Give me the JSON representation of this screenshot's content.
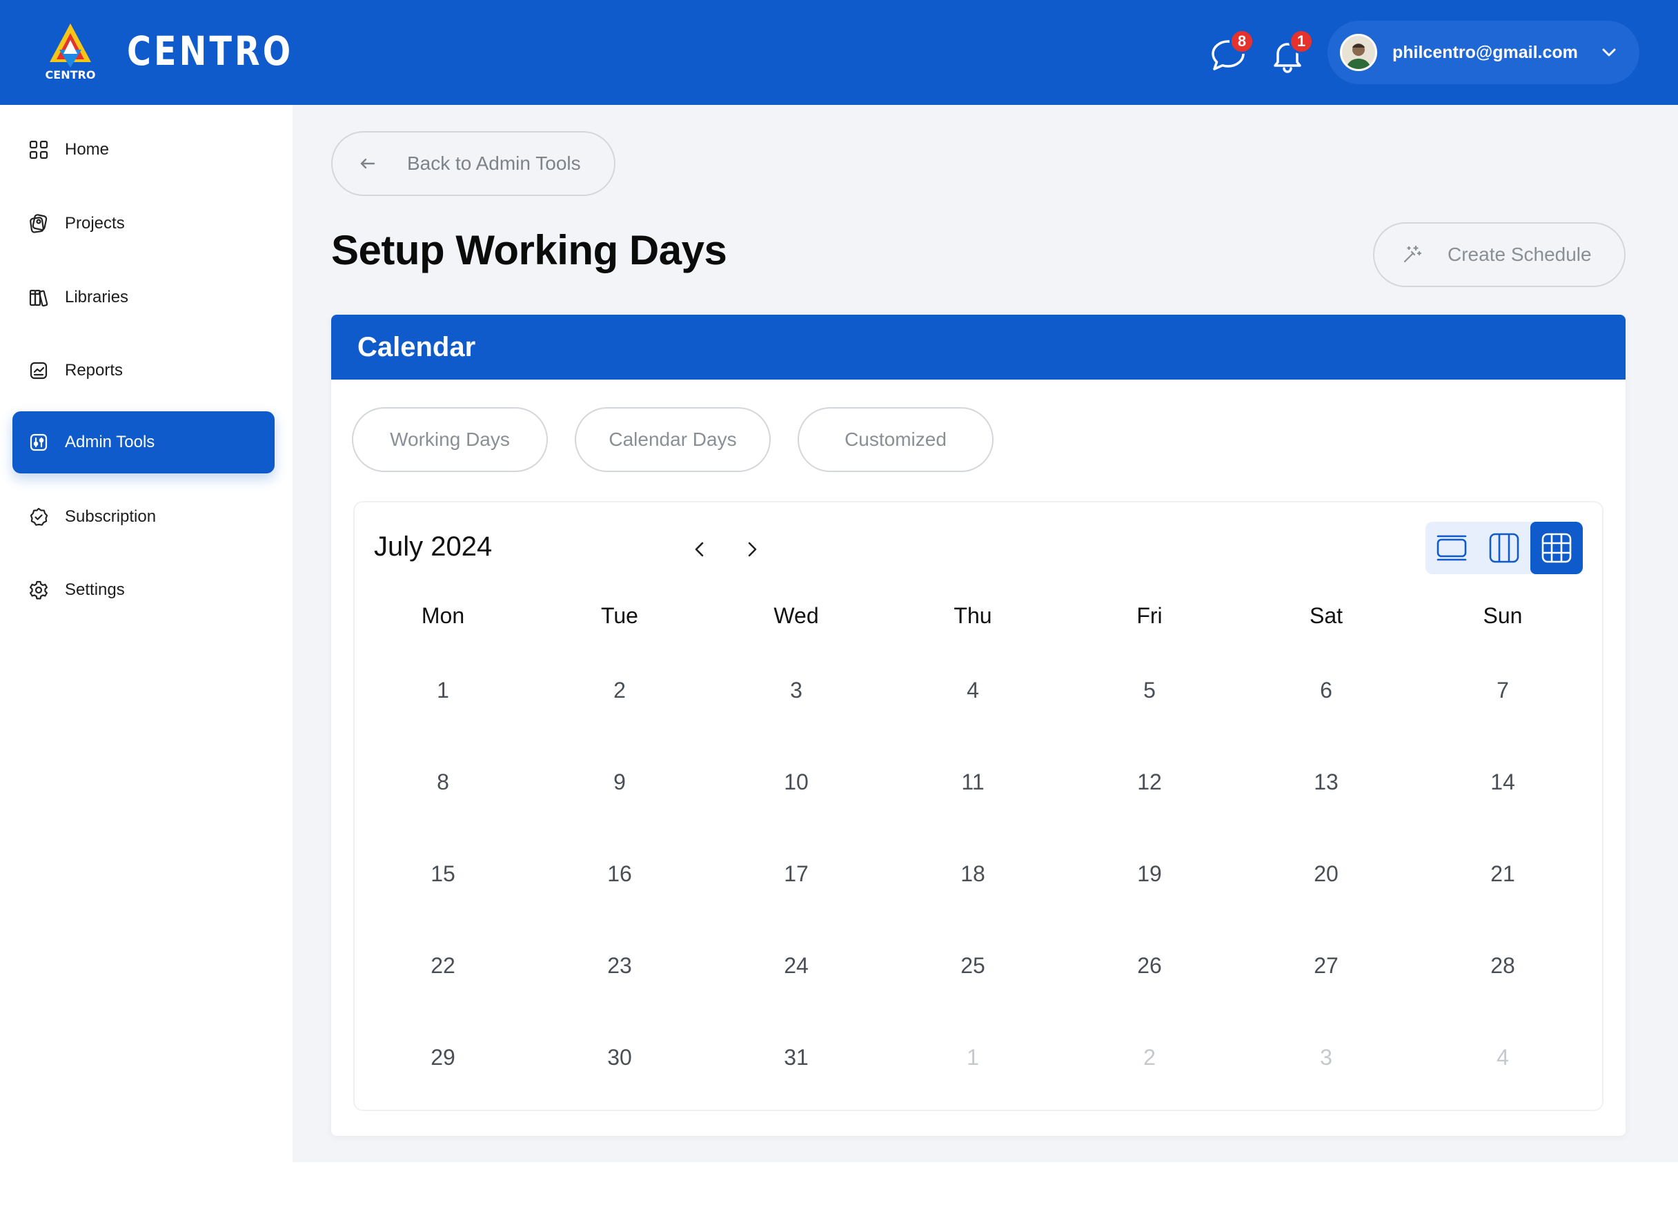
{
  "header": {
    "brand_name": "CENTRO",
    "logo_text": "CENTRO",
    "messages_count": "8",
    "notifications_count": "1",
    "user_email": "philcentro@gmail.com"
  },
  "sidebar": {
    "items": [
      {
        "label": "Home",
        "icon": "grid-icon"
      },
      {
        "label": "Projects",
        "icon": "projects-icon"
      },
      {
        "label": "Libraries",
        "icon": "books-icon"
      },
      {
        "label": "Reports",
        "icon": "report-icon"
      },
      {
        "label": "Admin Tools",
        "icon": "admin-tools-icon",
        "active": true
      },
      {
        "label": "Subscription",
        "icon": "badge-check-icon"
      },
      {
        "label": "Settings",
        "icon": "gear-icon"
      }
    ]
  },
  "main": {
    "back_label": "Back to Admin Tools",
    "page_title": "Setup Working Days",
    "create_label": "Create Schedule",
    "card_title": "Calendar",
    "tabs": [
      "Working Days",
      "Calendar Days",
      "Customized"
    ],
    "calendar": {
      "month_label": "July 2024",
      "weekdays": [
        "Mon",
        "Tue",
        "Wed",
        "Thu",
        "Fri",
        "Sat",
        "Sun"
      ],
      "weeks": [
        [
          "1",
          "2",
          "3",
          "4",
          "5",
          "6",
          "7"
        ],
        [
          "8",
          "9",
          "10",
          "11",
          "12",
          "13",
          "14"
        ],
        [
          "15",
          "16",
          "17",
          "18",
          "19",
          "20",
          "21"
        ],
        [
          "22",
          "23",
          "24",
          "25",
          "26",
          "27",
          "28"
        ],
        [
          "29",
          "30",
          "31",
          "1",
          "2",
          "3",
          "4"
        ]
      ],
      "next_month_days_in_last_row": 4,
      "views": [
        "day-view-icon",
        "week-view-icon",
        "month-view-icon"
      ],
      "active_view": "month-view-icon"
    }
  },
  "colors": {
    "primary": "#0f5bcb",
    "background": "#f2f4f7",
    "badge": "#e5322d"
  }
}
